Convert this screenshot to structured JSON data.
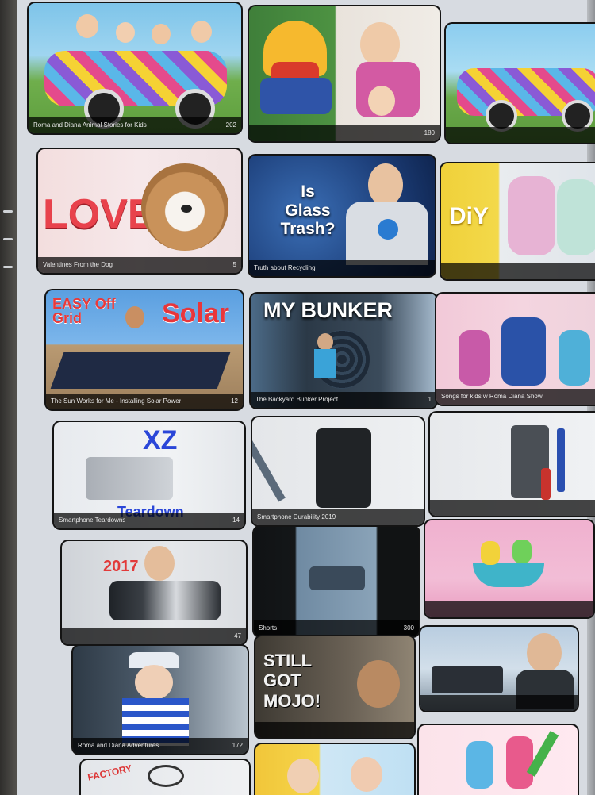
{
  "grid": {
    "row1": [
      {
        "title": "Roma and Diana Animal Stories for Kids",
        "count": "202"
      },
      {
        "title": "",
        "count": "180"
      },
      {
        "title": "",
        "count": ""
      }
    ],
    "row2": [
      {
        "title": "Valentines From the Dog",
        "count": "5",
        "overlay": "LOVE"
      },
      {
        "title": "Truth about Recycling",
        "count": "",
        "overlay": "Is Glass Trash?"
      },
      {
        "title": "",
        "count": "",
        "overlay": "DiY"
      }
    ],
    "row3": [
      {
        "title": "The Sun Works for Me - Installing Solar Power",
        "count": "12",
        "overlay_a": "EASY Off Grid",
        "overlay_b": "Solar"
      },
      {
        "title": "The Backyard Bunker Project",
        "count": "1",
        "overlay": "MY BUNKER"
      },
      {
        "title": "Songs for kids w Roma Diana Show",
        "count": ""
      }
    ],
    "row4": [
      {
        "title": "Smartphone Teardowns",
        "count": "14",
        "overlay_a": "XZ",
        "overlay_b": "Teardown"
      },
      {
        "title": "Smartphone Durability 2019",
        "count": ""
      },
      {
        "title": "",
        "count": ""
      }
    ],
    "row5": [
      {
        "title": "",
        "count": "47",
        "overlay": "2017"
      },
      {
        "title": "Shorts",
        "count": "300"
      },
      {
        "title": "",
        "count": ""
      }
    ],
    "row6": [
      {
        "title": "Roma and Diana Adventures",
        "count": "172"
      },
      {
        "title": "",
        "count": "",
        "overlay": "STILL GOT MOJO!"
      },
      {
        "title": "",
        "count": ""
      }
    ],
    "row7": [
      {
        "title": "",
        "count": "",
        "overlay": "FACTORY"
      },
      {
        "title": "",
        "count": ""
      },
      {
        "title": "",
        "count": ""
      }
    ]
  }
}
